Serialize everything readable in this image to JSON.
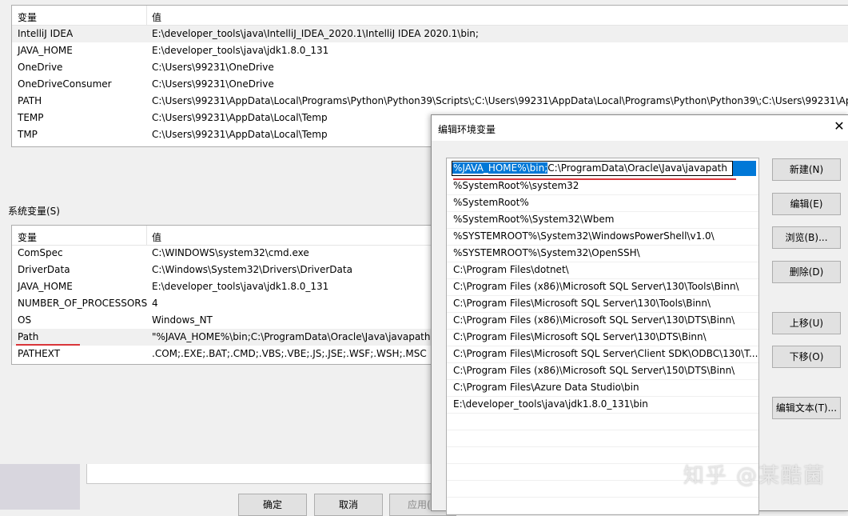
{
  "user_vars": {
    "header_name": "变量",
    "header_value": "值",
    "rows": [
      {
        "name": "IntelliJ IDEA",
        "value": "E:\\developer_tools\\java\\IntelliJ_IDEA_2020.1\\IntelliJ IDEA 2020.1\\bin;"
      },
      {
        "name": "JAVA_HOME",
        "value": "E:\\developer_tools\\java\\jdk1.8.0_131"
      },
      {
        "name": "OneDrive",
        "value": "C:\\Users\\99231\\OneDrive"
      },
      {
        "name": "OneDriveConsumer",
        "value": "C:\\Users\\99231\\OneDrive"
      },
      {
        "name": "PATH",
        "value": "C:\\Users\\99231\\AppData\\Local\\Programs\\Python\\Python39\\Scripts\\;C:\\Users\\99231\\AppData\\Local\\Programs\\Python\\Python39\\;C:\\Users\\99231\\AppD"
      },
      {
        "name": "TEMP",
        "value": "C:\\Users\\99231\\AppData\\Local\\Temp"
      },
      {
        "name": "TMP",
        "value": "C:\\Users\\99231\\AppData\\Local\\Temp"
      }
    ]
  },
  "system_vars": {
    "label": "系统变量(S)",
    "header_name": "变量",
    "header_value": "值",
    "rows": [
      {
        "name": "ComSpec",
        "value": "C:\\WINDOWS\\system32\\cmd.exe"
      },
      {
        "name": "DriverData",
        "value": "C:\\Windows\\System32\\Drivers\\DriverData"
      },
      {
        "name": "JAVA_HOME",
        "value": "E:\\developer_tools\\java\\jdk1.8.0_131"
      },
      {
        "name": "NUMBER_OF_PROCESSORS",
        "value": "4"
      },
      {
        "name": "OS",
        "value": "Windows_NT"
      },
      {
        "name": "Path",
        "value": "\"%JAVA_HOME%\\bin;C:\\ProgramData\\Oracle\\Java\\javapath\""
      },
      {
        "name": "PATHEXT",
        "value": ".COM;.EXE;.BAT;.CMD;.VBS;.VBE;.JS;.JSE;.WSF;.WSH;.MSC"
      }
    ]
  },
  "bottom_buttons": {
    "ok": "确定",
    "cancel": "取消",
    "apply": "应用("
  },
  "dialog": {
    "title": "编辑环境变量",
    "close": "✕",
    "editing_selected": "%JAVA_HOME%\\bin;",
    "editing_rest": "C:\\ProgramData\\Oracle\\Java\\javapath",
    "paths": [
      "%SystemRoot%\\system32",
      "%SystemRoot%",
      "%SystemRoot%\\System32\\Wbem",
      "%SYSTEMROOT%\\System32\\WindowsPowerShell\\v1.0\\",
      "%SYSTEMROOT%\\System32\\OpenSSH\\",
      "C:\\Program Files\\dotnet\\",
      "C:\\Program Files (x86)\\Microsoft SQL Server\\130\\Tools\\Binn\\",
      "C:\\Program Files\\Microsoft SQL Server\\130\\Tools\\Binn\\",
      "C:\\Program Files (x86)\\Microsoft SQL Server\\130\\DTS\\Binn\\",
      "C:\\Program Files\\Microsoft SQL Server\\130\\DTS\\Binn\\",
      "C:\\Program Files\\Microsoft SQL Server\\Client SDK\\ODBC\\130\\T...",
      "C:\\Program Files (x86)\\Microsoft SQL Server\\150\\DTS\\Binn\\",
      "C:\\Program Files\\Azure Data Studio\\bin",
      "E:\\developer_tools\\java\\jdk1.8.0_131\\bin"
    ],
    "buttons": {
      "new": "新建(N)",
      "edit": "编辑(E)",
      "browse": "浏览(B)...",
      "delete": "删除(D)",
      "move_up": "上移(U)",
      "move_down": "下移(O)",
      "edit_text": "编辑文本(T)..."
    }
  },
  "watermark": "知乎 @某酷菌"
}
